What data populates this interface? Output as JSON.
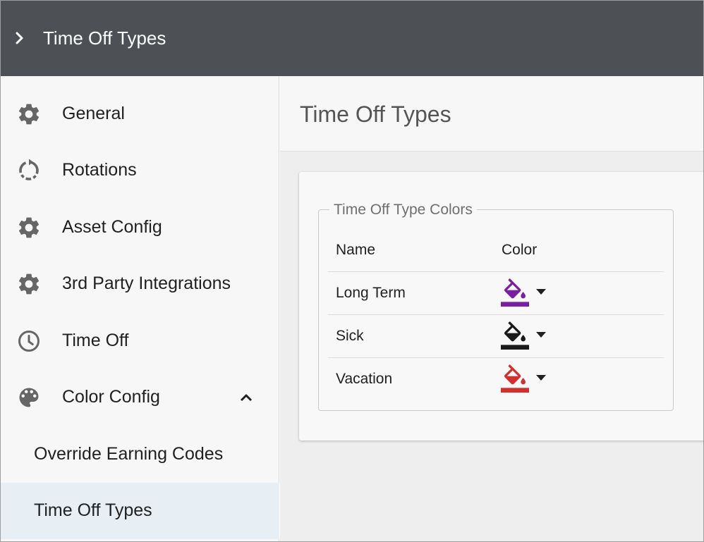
{
  "header": {
    "title": "Time Off Types"
  },
  "sidebar": {
    "items": [
      {
        "label": "General",
        "icon": "gear-icon"
      },
      {
        "label": "Rotations",
        "icon": "rotate-icon"
      },
      {
        "label": "Asset Config",
        "icon": "gear-icon"
      },
      {
        "label": "3rd Party Integrations",
        "icon": "gear-icon"
      },
      {
        "label": "Time Off",
        "icon": "clock-icon"
      },
      {
        "label": "Color Config",
        "icon": "palette-icon",
        "expanded": true
      }
    ],
    "subitems": [
      {
        "label": "Override Earning Codes"
      },
      {
        "label": "Time Off Types",
        "active": true
      }
    ]
  },
  "main": {
    "title": "Time Off Types",
    "section_legend": "Time Off Type Colors",
    "columns": [
      "Name",
      "Color"
    ],
    "rows": [
      {
        "name": "Long Term",
        "color": "#7b1fa2"
      },
      {
        "name": "Sick",
        "color": "#1a1a1a"
      },
      {
        "name": "Vacation",
        "color": "#d32f2f"
      }
    ]
  },
  "colors": {
    "appbar": "#4d5155",
    "active_item": "#e7eff5",
    "icon_gray": "#666666"
  }
}
